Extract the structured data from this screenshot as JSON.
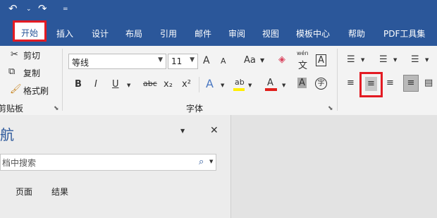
{
  "qat": {
    "undo_icon": "undo-icon",
    "redo_icon": "redo-icon"
  },
  "tabs": [
    "开始",
    "插入",
    "设计",
    "布局",
    "引用",
    "邮件",
    "审阅",
    "视图",
    "模板中心",
    "帮助",
    "PDF工具集"
  ],
  "active_tab": "开始",
  "clipboard": {
    "cut_label": "剪切",
    "copy_label": "复制",
    "format_painter_label": "格式刷",
    "group_label": "剪贴板"
  },
  "font": {
    "font_name": "等线",
    "font_size": "11",
    "group_label": "字体",
    "bold": "B",
    "italic": "I",
    "underline": "U",
    "strikethrough": "abc",
    "subscript": "x₂",
    "superscript": "x²",
    "grow": "A",
    "shrink": "A",
    "change_case": "Aa",
    "phonetic_top": "wén",
    "phonetic_bottom": "文",
    "border_char": "A",
    "highlight": "ab",
    "font_color": "A",
    "shading": "A",
    "enclose": "字"
  },
  "colors": {
    "title_bar": "#2b579a",
    "highlight_bar": "#ffee00",
    "font_color_bar": "#e0201b",
    "annotation_red": "#e31b23"
  },
  "nav": {
    "title": "航",
    "search_placeholder": "档中搜索",
    "tab_pages": "页面",
    "tab_results": "结果"
  }
}
